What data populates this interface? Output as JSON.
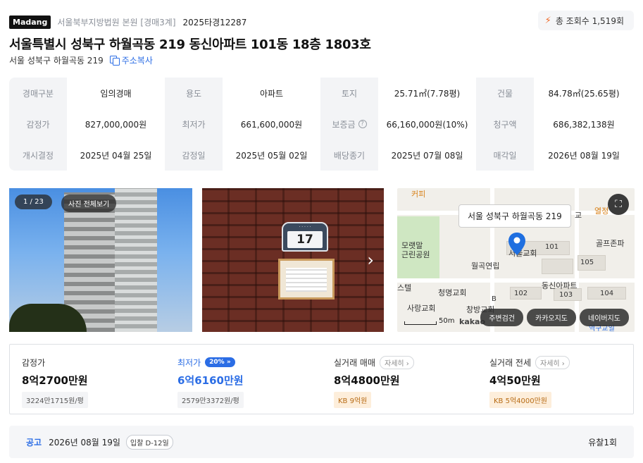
{
  "header": {
    "logo": "Madang",
    "court": "서울북부지방법원 본원 [경매3계]",
    "case_no": "2025타경12287",
    "views": "총 조회수 1,519회"
  },
  "title": "서울특별시 성북구 하월곡동 219 동신아파트 101동 18층 1803호",
  "subaddress": "서울 성북구 하월곡동 219",
  "copy_label": "주소복사",
  "info": [
    [
      "경매구분",
      "임의경매",
      "용도",
      "아파트",
      "토지",
      "25.71㎡(7.78평)",
      "건물",
      "84.78㎡(25.65평)"
    ],
    [
      "감정가",
      "827,000,000원",
      "최저가",
      "661,600,000원",
      "보증금",
      "66,160,000원(10%)",
      "청구액",
      "686,382,138원"
    ],
    [
      "개시결정",
      "2025년 04월 25일",
      "감정일",
      "2025년 05월 02일",
      "배당종기",
      "2025년 07월 08일",
      "매각일",
      "2026년 08월 19일"
    ]
  ],
  "gallery": {
    "count": "1 / 23",
    "view_all": "사진 전체보기",
    "plate_number": "17"
  },
  "map": {
    "tooltip": "서울 성북구 하월곡동 219",
    "labels": {
      "coffee": "커피",
      "park": "모랫말\n근린공원",
      "church1": "서울교회",
      "church2": "청명교회",
      "church3": "사랑교회",
      "church4": "창방교회",
      "weolgok": "월곡연립",
      "dongshin": "동신아파트",
      "gollf": "골프존파",
      "kyo": "교",
      "yeolsam": "열정",
      "b101": "101",
      "b102": "102",
      "b103": "103",
      "b104": "104",
      "b105": "105",
      "b": "B",
      "stel": "스텔",
      "bottom_right": "역구교일"
    },
    "scale": "50m",
    "brand": "kakao",
    "buttons": [
      "주변검건",
      "카카오지도",
      "네이버지도"
    ]
  },
  "prices": {
    "appraisal": {
      "label": "감정가",
      "value": "8억2700만원",
      "sub": "3224만1715원/평"
    },
    "minimum": {
      "label": "최저가",
      "pct": "20%",
      "value": "6억6160만원",
      "sub": "2579만3372원/평"
    },
    "trade": {
      "label": "실거래 매매",
      "detail": "자세히",
      "value": "8억4800만원",
      "kb": "KB 9억원"
    },
    "jeonse": {
      "label": "실거래 전세",
      "detail": "자세히",
      "value": "4억50만원",
      "kb": "KB 5억4000만원"
    }
  },
  "notice": {
    "title": "공고",
    "date": "2026년 08월 19일",
    "dday": "입찰 D-12일",
    "result": "유찰1회"
  },
  "colors": {
    "accent": "#2b6de5",
    "kb_bg": "#fdeedb",
    "kb_text": "#b76b14",
    "pin": "#1f6fe0"
  }
}
